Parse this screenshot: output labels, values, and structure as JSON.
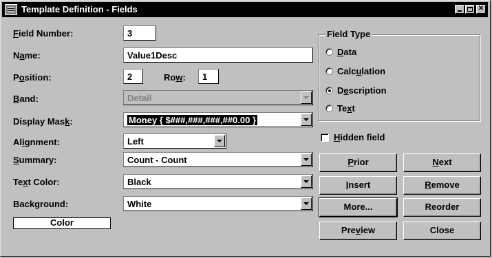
{
  "window": {
    "title": "Template Definition - Fields"
  },
  "form": {
    "field_number": {
      "label_pre": "",
      "label_u": "F",
      "label_post": "ield Number:",
      "value": "3"
    },
    "name": {
      "label_pre": "N",
      "label_u": "a",
      "label_post": "me:",
      "value": "Value1Desc"
    },
    "position": {
      "label_pre": "P",
      "label_u": "o",
      "label_post": "sition:",
      "value": "2"
    },
    "row": {
      "label_pre": "Ro",
      "label_u": "w",
      "label_post": ":",
      "value": "1"
    },
    "band": {
      "label_pre": "",
      "label_u": "B",
      "label_post": "and:",
      "value": "Detail"
    },
    "display_mask": {
      "label_pre": "Display Mas",
      "label_u": "k",
      "label_post": ":",
      "value": "Money { $###,###,###,##0.00 }"
    },
    "alignment": {
      "label_pre": "Al",
      "label_u": "i",
      "label_post": "gnment:",
      "value": "Left"
    },
    "summary": {
      "label_pre": "",
      "label_u": "S",
      "label_post": "ummary:",
      "value": "Count - Count"
    },
    "text_color": {
      "label_pre": "Te",
      "label_u": "x",
      "label_post": "t Color:",
      "value": "Black"
    },
    "background": {
      "label_pre": "Back",
      "label_u": "g",
      "label_post": "round:",
      "value": "White"
    },
    "color_button": "Color"
  },
  "field_type": {
    "title": "Field Type",
    "options": [
      {
        "pre": "",
        "u": "D",
        "post": "ata",
        "checked": false
      },
      {
        "pre": "Calc",
        "u": "u",
        "post": "lation",
        "checked": false
      },
      {
        "pre": "D",
        "u": "e",
        "post": "scription",
        "checked": true
      },
      {
        "pre": "Te",
        "u": "x",
        "post": "t",
        "checked": false
      }
    ]
  },
  "hidden_field": {
    "pre": "",
    "u": "H",
    "post": "idden field",
    "checked": false
  },
  "buttons": {
    "prior": {
      "pre": "",
      "u": "P",
      "post": "rior"
    },
    "next": {
      "pre": "",
      "u": "N",
      "post": "ext"
    },
    "insert": {
      "pre": "",
      "u": "I",
      "post": "nsert"
    },
    "remove": {
      "pre": "",
      "u": "R",
      "post": "emove"
    },
    "more": {
      "pre": "More...",
      "u": "",
      "post": ""
    },
    "reorder": {
      "pre": "Reorder",
      "u": "",
      "post": ""
    },
    "preview": {
      "pre": "Pre",
      "u": "v",
      "post": "iew"
    },
    "close": {
      "pre": "Close",
      "u": "",
      "post": ""
    }
  }
}
